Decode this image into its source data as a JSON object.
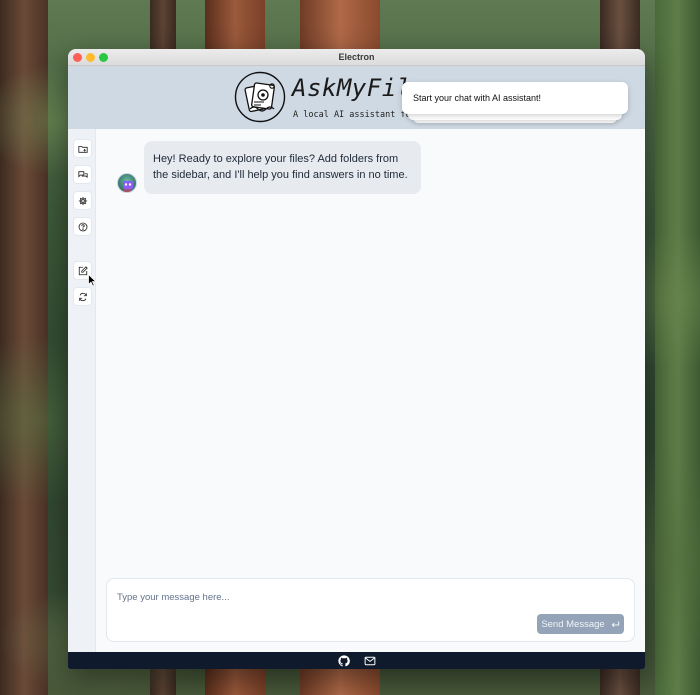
{
  "window": {
    "title": "Electron"
  },
  "header": {
    "app_name": "AskMyFil",
    "subtitle": "A local AI assistant fo",
    "toast": "Start your chat with AI assistant!"
  },
  "sidebar": {
    "items": [
      {
        "icon": "folder-plus-icon"
      },
      {
        "icon": "chat-bubbles-icon"
      },
      {
        "icon": "gear-icon"
      },
      {
        "icon": "help-circle-icon"
      },
      {
        "icon": "edit-icon"
      },
      {
        "icon": "refresh-icon"
      }
    ]
  },
  "chat": {
    "messages": [
      {
        "role": "assistant",
        "text": "Hey! Ready to explore your files? Add folders from the sidebar, and I'll help you find answers in no time."
      }
    ]
  },
  "composer": {
    "placeholder": "Type your message here...",
    "send_label": "Send Message",
    "send_icon": "return-icon"
  },
  "footer": {
    "icons": [
      "github-icon",
      "mail-icon"
    ]
  },
  "colors": {
    "header_bg": "#cfd9e3",
    "footer_bg": "#0f1b2d",
    "send_button": "#94a3b8",
    "bubble_bg": "#e7ebf0"
  }
}
